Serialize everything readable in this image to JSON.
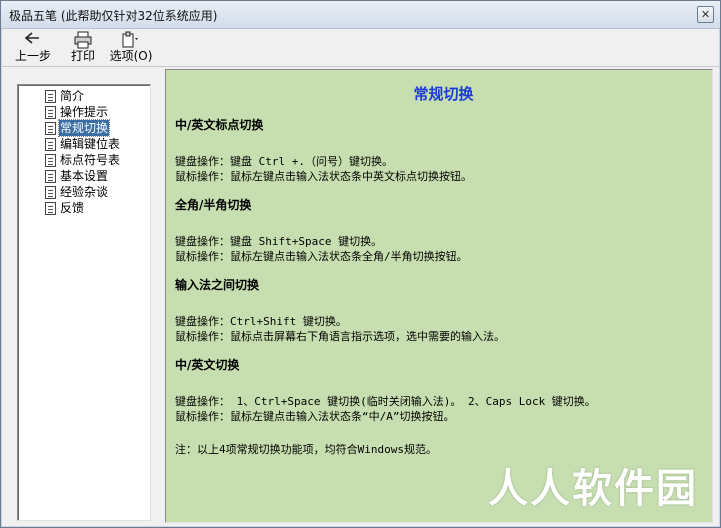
{
  "window": {
    "title": "极品五笔 (此帮助仅针对32位系统应用)",
    "close_symbol": "✕"
  },
  "toolbar": {
    "back_label": "上一步",
    "back_icon": "back-arrow-icon",
    "print_label": "打印",
    "print_icon": "printer-icon",
    "options_label": "选项(O)",
    "options_icon": "options-icon"
  },
  "nav": {
    "items": [
      {
        "label": "简介",
        "selected": false
      },
      {
        "label": "操作提示",
        "selected": false
      },
      {
        "label": "常规切换",
        "selected": true
      },
      {
        "label": "编辑键位表",
        "selected": false
      },
      {
        "label": "标点符号表",
        "selected": false
      },
      {
        "label": "基本设置",
        "selected": false
      },
      {
        "label": "经验杂谈",
        "selected": false
      },
      {
        "label": "反馈",
        "selected": false
      }
    ]
  },
  "content": {
    "title": "常规切换",
    "sections": [
      {
        "heading": "中/英文标点切换",
        "lines": [
          "键盘操作：键盘 Ctrl +.（问号）键切换。",
          "鼠标操作：鼠标左键点击输入法状态条中英文标点切换按钮。"
        ]
      },
      {
        "heading": "全角/半角切换",
        "lines": [
          "键盘操作：键盘 Shift+Space 键切换。",
          "鼠标操作：鼠标左键点击输入法状态条全角/半角切换按钮。"
        ]
      },
      {
        "heading": "输入法之间切换",
        "lines": [
          "键盘操作：Ctrl+Shift 键切换。",
          "鼠标操作：鼠标点击屏幕右下角语言指示选项，选中需要的输入法。"
        ]
      },
      {
        "heading": "中/英文切换",
        "lines": [
          "键盘操作： 1、Ctrl+Space 键切换(临时关闭输入法)。 2、Caps Lock 键切换。",
          "鼠标操作：鼠标左键点击输入法状态条“中/A”切换按钮。"
        ]
      }
    ],
    "note": "注：以上4项常规切换功能项，均符合Windows规范。"
  },
  "watermark": "人人软件园",
  "colors": {
    "content_bg": "#c7dfb0",
    "title_blue": "#1b3bd6",
    "selection": "#3a6ea5"
  }
}
